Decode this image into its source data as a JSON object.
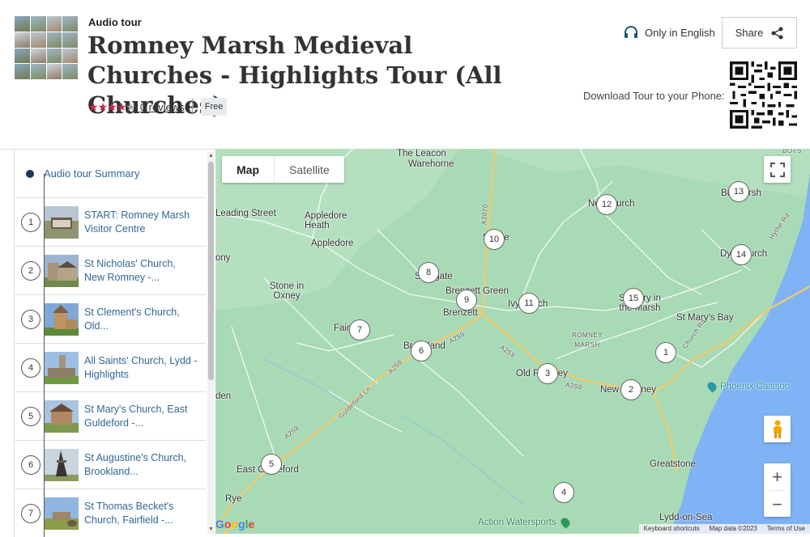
{
  "header": {
    "tour_label": "Audio tour",
    "title": "Romney Marsh Medieval Churches - Highlights Tour (All Churches)",
    "rating_stars": 4,
    "reviews_count": "0",
    "reviews_label": "reviews",
    "price_badge": "Free",
    "language": "Only in English",
    "share_label": "Share",
    "download_label": "Download Tour to your Phone:",
    "icons": [
      "headphones-icon",
      "share-icon",
      "qr-code",
      "star-icon"
    ],
    "colors": {
      "star": "#c8284d",
      "link": "#336699"
    }
  },
  "sidebar": {
    "summary_label": "Audio tour Summary",
    "stops": [
      {
        "num": "1",
        "label": "START: Romney Marsh Visitor Centre"
      },
      {
        "num": "2",
        "label": "St Nicholas' Church, New Romney -..."
      },
      {
        "num": "3",
        "label": "St Clement's Church, Old..."
      },
      {
        "num": "4",
        "label": "All Saints' Church, Lydd - Highlights"
      },
      {
        "num": "5",
        "label": "St Mary's Church, East Guldeford -..."
      },
      {
        "num": "6",
        "label": "St Augustine's Church, Brookland..."
      },
      {
        "num": "7",
        "label": "St Thomas Becket's Church, Fairfield -..."
      }
    ]
  },
  "map": {
    "type_map": "Map",
    "type_satellite": "Satellite",
    "zoom_in": "+",
    "zoom_out": "−",
    "places": {
      "the_leacon": "The Leacon",
      "warehorne": "Warehorne",
      "leading_street": "Leading Street",
      "appledore_heath": "Appledore Heath",
      "appledore": "Appledore",
      "ony": "ony",
      "stone_in_oxney": "Stone in Oxney",
      "snargate": "Snargate",
      "brenzett_green": "Brenzett Green",
      "brenzett": "Brenzett",
      "fairfield": "Fair",
      "brookland": "Brookland",
      "ivychurch": "Ivychurch",
      "newchurch": "Newchurch",
      "snave": "Snave",
      "burmarsh": "Burmarsh",
      "dymchurch": "Dymchurch",
      "st_mary_in_marsh": "St Mary in the Marsh",
      "st_marys_bay": "St Mary's Bay",
      "romney_marsh": "ROMNEY MARSH",
      "old_romney": "Old Romney",
      "new_romney": "New Romney",
      "phoenix_caisson": "Phoenix Caisson",
      "east_guldeford": "East Guldeford",
      "rye": "Rye",
      "greatstone": "Greatstone",
      "action_watersports": "Action Watersports",
      "lydd_on_sea": "Lydd-on-Sea",
      "den": "den",
      "bots": "BOTS",
      "a259": "A259",
      "a2070": "A2070",
      "guldeford_ln": "Guldeford Ln",
      "hythe_rd": "Hythe Rd",
      "church_rd": "Church Rd"
    },
    "markers": [
      "1",
      "2",
      "3",
      "4",
      "5",
      "6",
      "7",
      "8",
      "9",
      "10",
      "11",
      "12",
      "13",
      "14",
      "15"
    ],
    "attribution": {
      "logo": "Google",
      "shortcuts": "Keyboard shortcuts",
      "data": "Map data ©2023",
      "terms": "Terms of Use"
    },
    "colors": {
      "land": "#a8dab5",
      "sea": "#7fb3f5",
      "road_major": "#f4c96a",
      "road_minor": "#ffffff"
    }
  }
}
